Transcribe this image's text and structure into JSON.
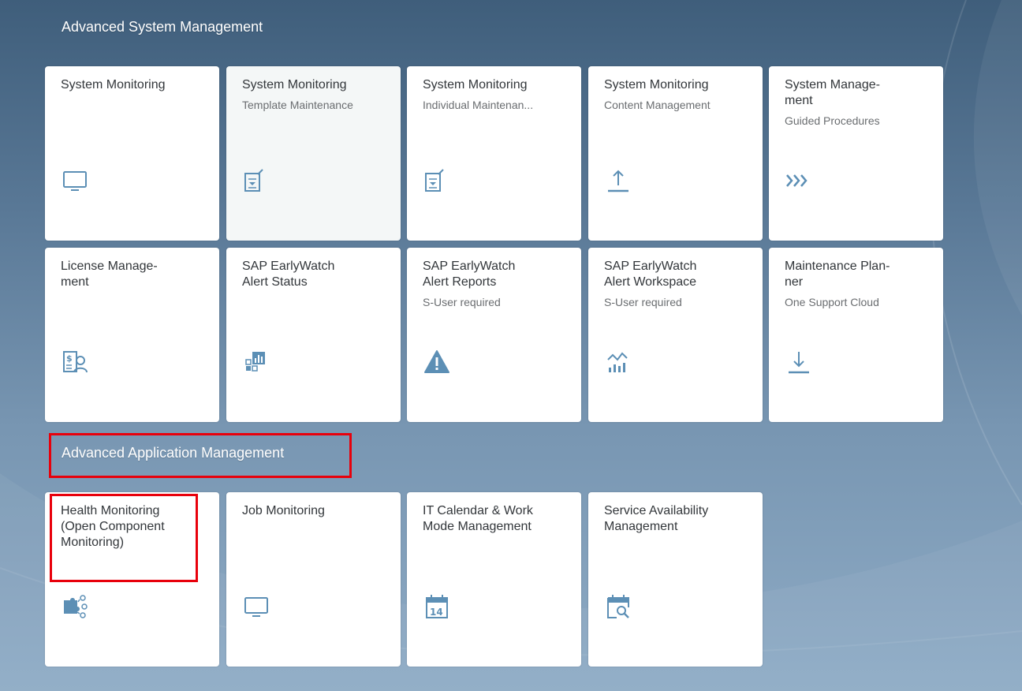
{
  "groups": [
    {
      "title": "Advanced System Management",
      "tiles": [
        {
          "title": "System Monitoring",
          "subtitle": "",
          "icon": "monitor-icon"
        },
        {
          "title": "System Monitoring",
          "subtitle": "Template Maintenance",
          "icon": "edit-document-icon"
        },
        {
          "title": "System Monitoring",
          "subtitle": "Individual Maintenan...",
          "icon": "edit-document-icon"
        },
        {
          "title": "System Monitoring",
          "subtitle": "Content Management",
          "icon": "upload-icon"
        },
        {
          "title": "System Manage-\nment",
          "subtitle": "Guided Procedures",
          "icon": "process-icon"
        },
        {
          "title": "License Manage-\nment",
          "subtitle": "",
          "icon": "license-icon"
        },
        {
          "title": "SAP EarlyWatch\nAlert Status",
          "subtitle": "",
          "icon": "dashboard-icon"
        },
        {
          "title": "SAP EarlyWatch\nAlert Reports",
          "subtitle": "S-User required",
          "icon": "warning-icon"
        },
        {
          "title": "SAP EarlyWatch\nAlert Workspace",
          "subtitle": "S-User required",
          "icon": "performance-chart-icon"
        },
        {
          "title": "Maintenance Plan-\nner",
          "subtitle": "One Support Cloud",
          "icon": "download-icon"
        }
      ]
    },
    {
      "title": "Advanced Application Management",
      "tiles": [
        {
          "title": "Health Monitoring\n(Open Component\nMonitoring)",
          "subtitle": "",
          "icon": "puzzle-network-icon"
        },
        {
          "title": "Job Monitoring",
          "subtitle": "",
          "icon": "monitor-icon"
        },
        {
          "title": "IT Calendar & Work\nMode Management",
          "subtitle": "",
          "icon": "calendar-icon"
        },
        {
          "title": "Service Availability\nManagement",
          "subtitle": "",
          "icon": "calendar-search-icon"
        }
      ]
    }
  ],
  "colors": {
    "icon": "#5c8fb5",
    "highlight": "#e8000b",
    "tile_text": "#32363a",
    "tile_subtext": "#6a6d70"
  }
}
